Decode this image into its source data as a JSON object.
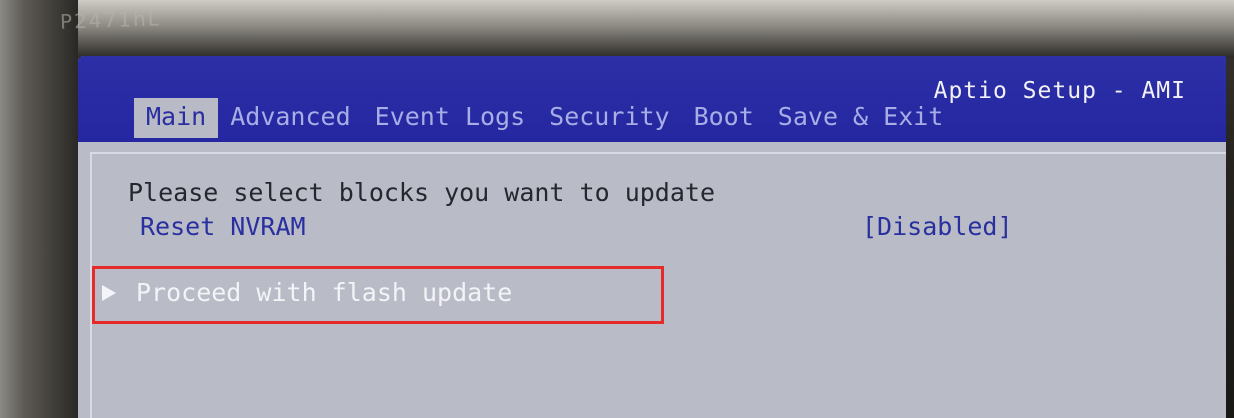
{
  "bezel": {
    "label": "P2471hL"
  },
  "header": {
    "brand": "Aptio Setup - AMI"
  },
  "tabs": [
    {
      "label": "Main",
      "active": true
    },
    {
      "label": "Advanced",
      "active": false
    },
    {
      "label": "Event Logs",
      "active": false
    },
    {
      "label": "Security",
      "active": false
    },
    {
      "label": "Boot",
      "active": false
    },
    {
      "label": "Save & Exit",
      "active": false
    }
  ],
  "main": {
    "help_text": "Please select blocks you want to update",
    "reset_nvram": {
      "label": "Reset NVRAM",
      "value": "[Disabled]"
    },
    "proceed": {
      "label": "Proceed with flash update",
      "icon": "play-arrow-icon"
    }
  },
  "colors": {
    "header_bg": "#2427a0",
    "screen_bg": "#b9bcc6",
    "tab_inactive": "#a8ade6",
    "option_text": "#2a2fa0",
    "highlight": "#e52a2a"
  }
}
